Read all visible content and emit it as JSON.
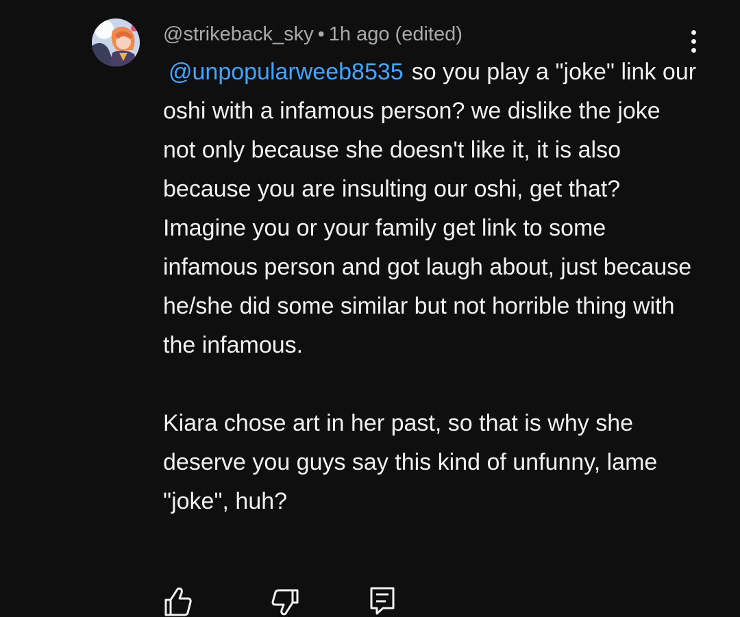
{
  "comment": {
    "author": "@strikeback_sky",
    "separator": "•",
    "timestamp": "1h ago",
    "edited_label": "(edited)",
    "mention": "@unpopularweeb8535",
    "text_first_line": "so you play a \"joke\"",
    "paragraph1_rest": "link our oshi with a infamous person? we dislike the joke not only because she doesn't like it, it is also because you are insulting our oshi, get that? Imagine you or your family get link to some infamous person and got laugh about, just because he/she did some similar but not horrible thing with the infamous.",
    "paragraph2": "Kiara chose art in her past, so that is why she deserve you guys say this kind of unfunny, lame \"joke\", huh?",
    "avatar_icon": "anime-character-avatar",
    "menu_icon": "more-vertical-icon"
  },
  "actions": {
    "like_icon": "thumbs-up-icon",
    "dislike_icon": "thumbs-down-icon",
    "reply_icon": "reply-comment-icon"
  },
  "colors": {
    "background": "#0f0f0f",
    "text": "#f1f1f1",
    "secondary_text": "#aaaaaa",
    "mention": "#3ea6ff"
  }
}
